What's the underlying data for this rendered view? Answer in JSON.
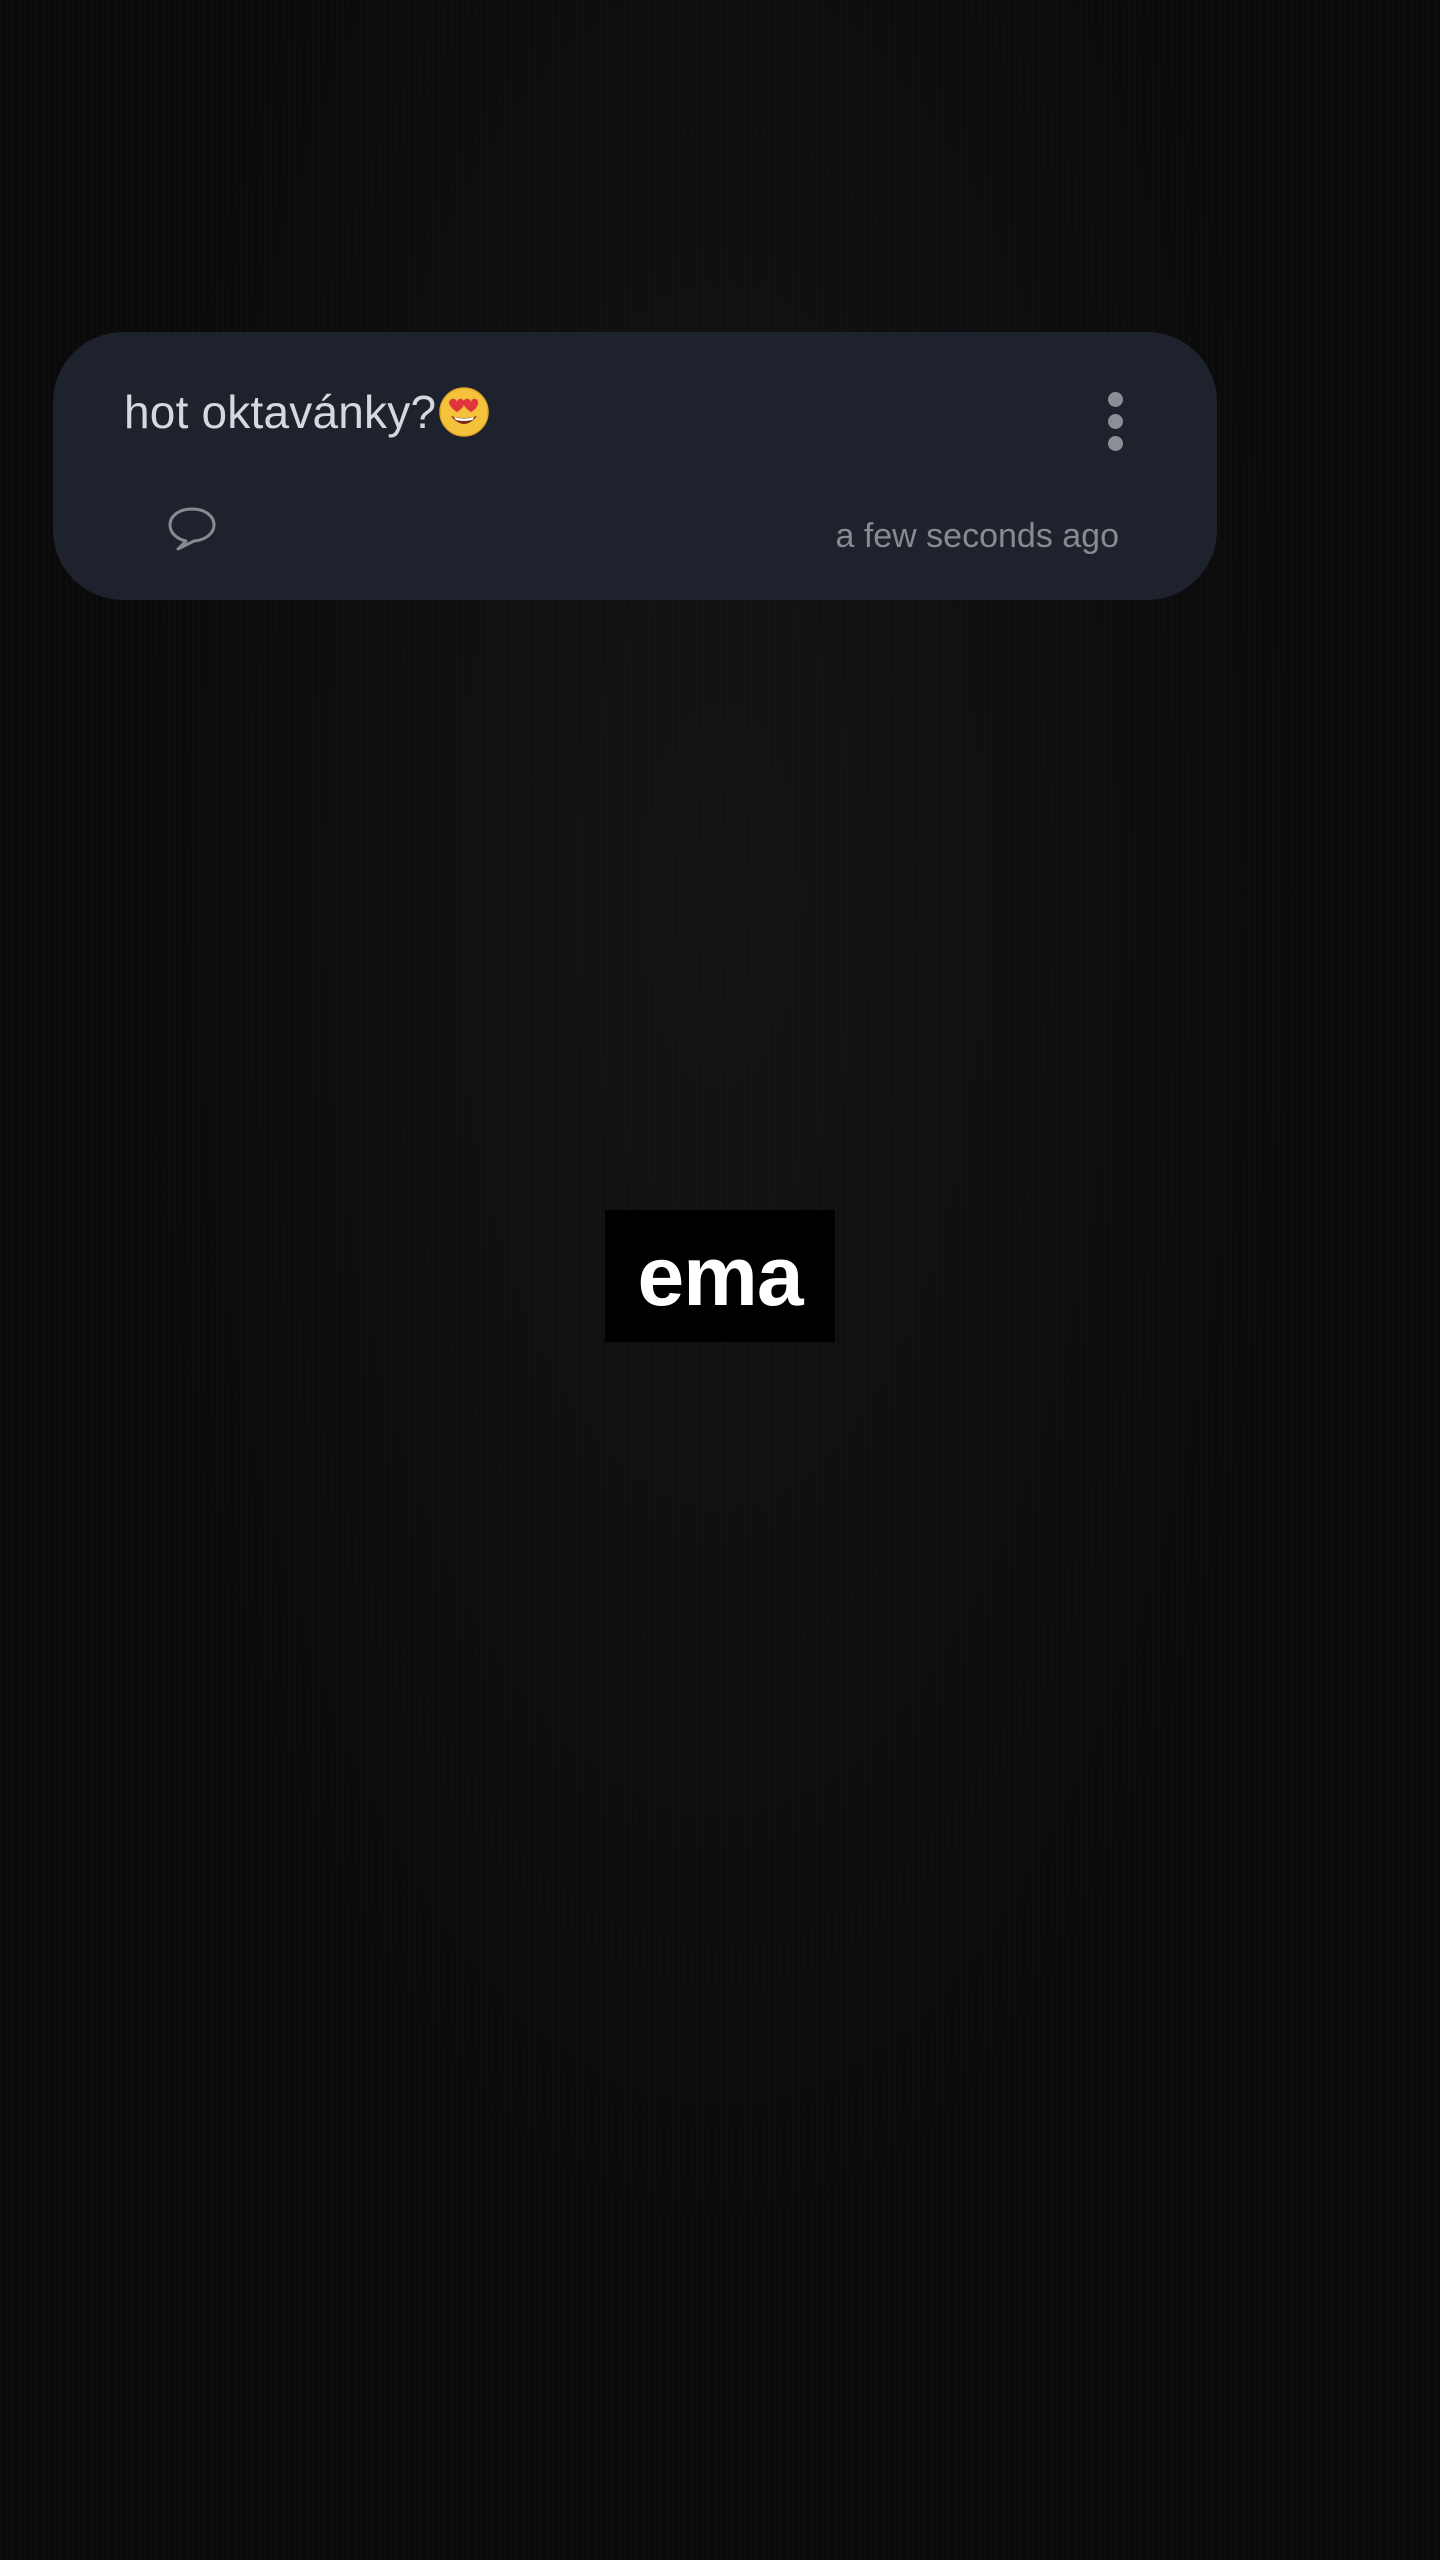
{
  "post": {
    "text": "hot oktavánky?",
    "emoji": "smiling-face-with-heart-eyes",
    "timestamp": "a few seconds ago",
    "more_icon": "more-vertical-icon",
    "comment_icon": "comment-bubble-icon"
  },
  "overlay": {
    "label": "ema"
  },
  "colors": {
    "background": "#0a0a0b",
    "card": "#1d222c",
    "text": "#d5d8dd",
    "muted": "#868a91"
  }
}
